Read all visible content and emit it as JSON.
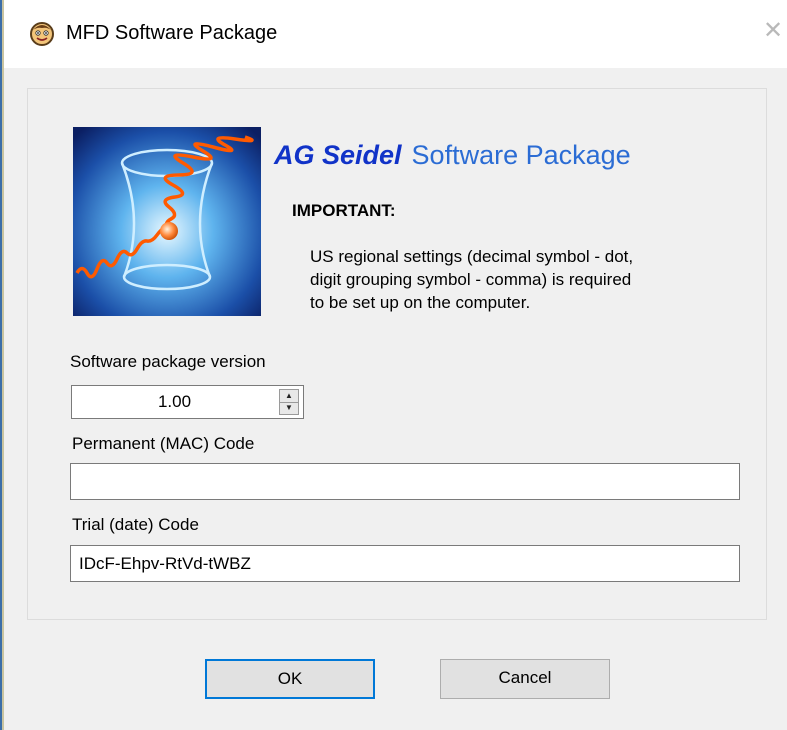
{
  "window": {
    "title": "MFD Software Package",
    "close_glyph": "✕",
    "icon": "app-face-icon"
  },
  "brand": {
    "bold": "AG Seidel",
    "rest": "Software Package",
    "bold_color": "#1133c8",
    "rest_color": "#2b6cd4"
  },
  "notice": {
    "heading": "IMPORTANT:",
    "lines": [
      "US regional settings (decimal symbol - dot,",
      "digit grouping symbol - comma) is required",
      "to be set up on the computer."
    ]
  },
  "version": {
    "label": "Software package version",
    "value": "1.00"
  },
  "permanent": {
    "label": "Permanent (MAC) Code",
    "value": ""
  },
  "trial": {
    "label": "Trial (date) Code",
    "value": "IDcF-Ehpv-RtVd-tWBZ"
  },
  "buttons": {
    "ok": "OK",
    "cancel": "Cancel"
  },
  "colors": {
    "accent": "#0078d7"
  }
}
